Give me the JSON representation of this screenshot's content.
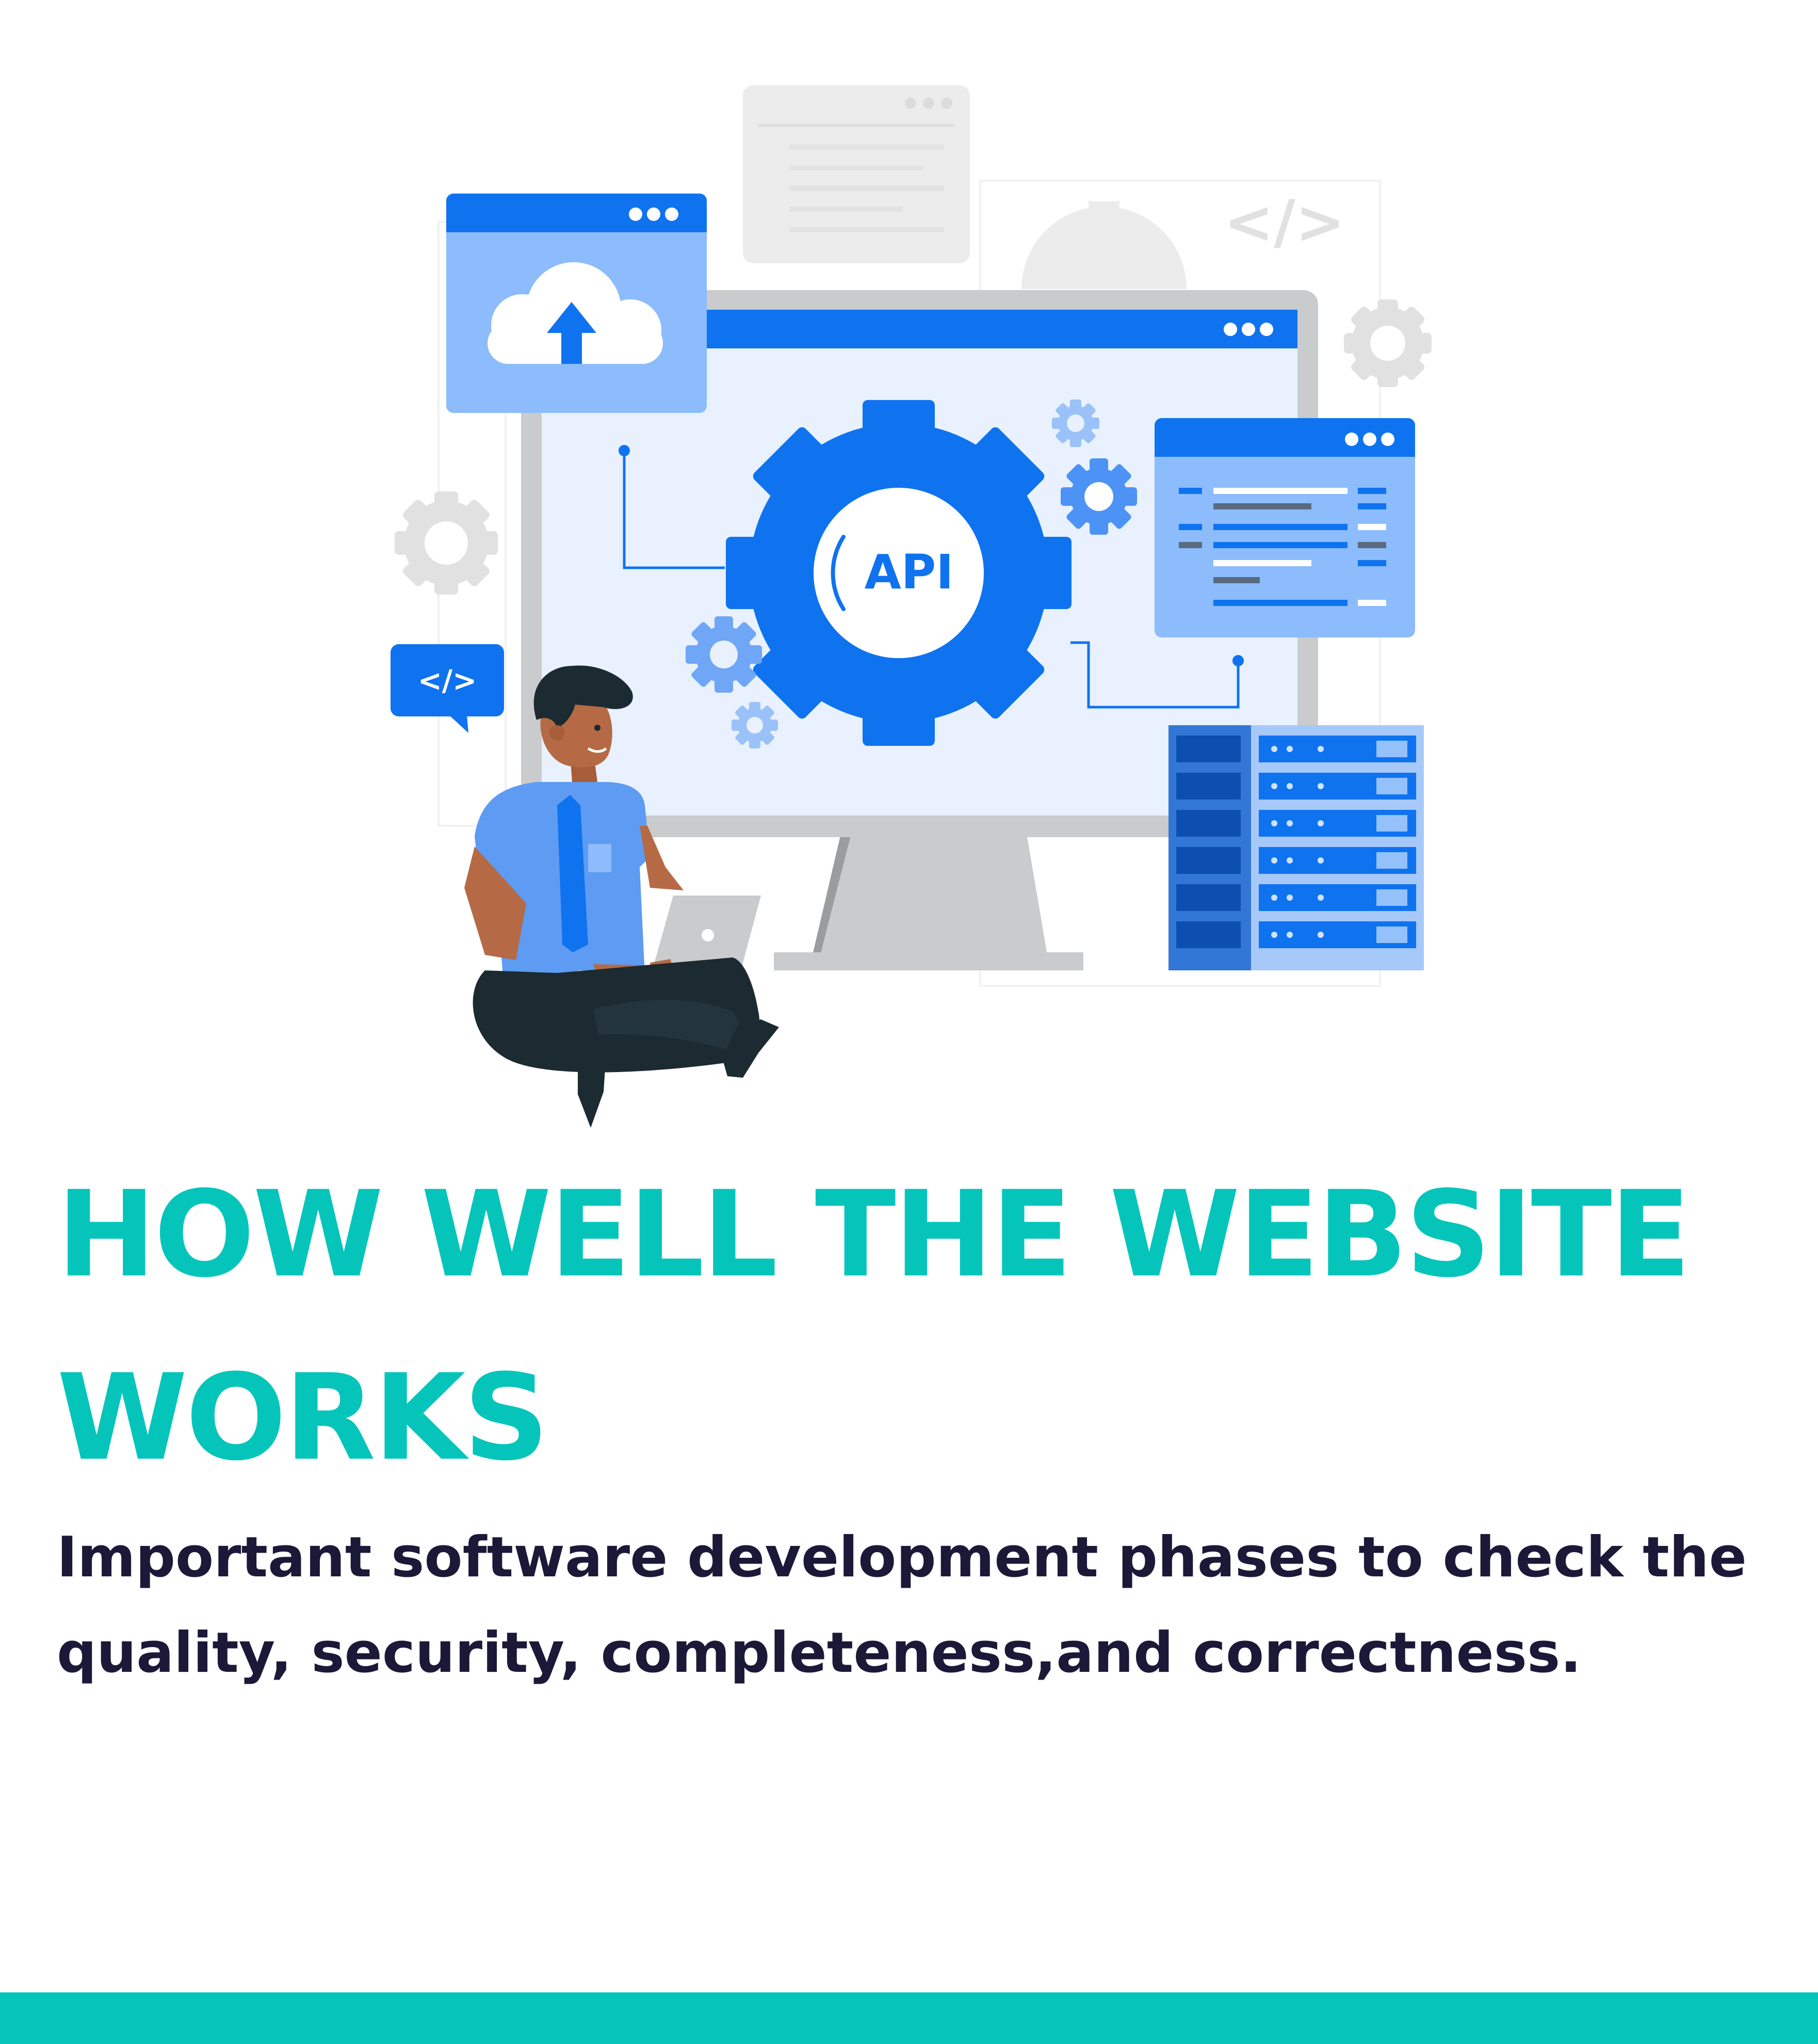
{
  "illustration": {
    "api_label": "API",
    "code_tag": "</>",
    "ghost_code_tag": "</>",
    "colors": {
      "primary_blue": "#0f73f0",
      "light_blue": "#8cbcfb",
      "pale_blue": "#e8f1fd",
      "monitor_gray": "#c9cbcc",
      "ghost_gray": "#e6e6e6",
      "skin": "#b56a45",
      "pants": "#1c2a32"
    },
    "icons": [
      "cloud-upload-icon",
      "api-gear-icon",
      "code-tag-icon",
      "gear-icon",
      "server-rack-icon",
      "laptop-icon"
    ]
  },
  "content": {
    "headline_line1": "HOW WELL THE WEBSITE",
    "headline_line2": "WORKS",
    "description_line1": "Important software development phases to check the",
    "description_line2": "quality, security, completeness,and correctness."
  },
  "theme": {
    "accent": "#05c5bb",
    "text_dark": "#1c1838",
    "background": "#ffffff"
  }
}
